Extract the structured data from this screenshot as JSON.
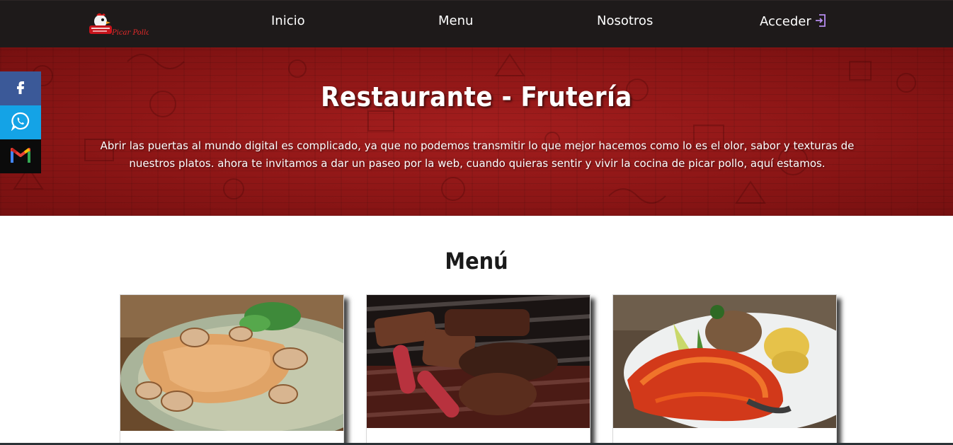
{
  "navbar": {
    "logo_icon": "restaurant-logo",
    "logo_text": "Picar Pollo",
    "links": [
      {
        "label": "Inicio"
      },
      {
        "label": "Menu"
      },
      {
        "label": "Nosotros"
      },
      {
        "label": "Acceder",
        "icon": "login-arrow-icon"
      }
    ]
  },
  "hero": {
    "title": "Restaurante - Frutería",
    "text": "Abrir las puertas al mundo digital es complicado, ya que no podemos transmitir lo que mejor hacemos como lo es el olor, sabor y texturas de nuestros platos. ahora te invitamos a dar un paseo por la web, cuando quieras sentir y vivir la cocina de picar pollo, aquí estamos."
  },
  "social": [
    {
      "icon": "facebook-icon"
    },
    {
      "icon": "whatsapp-icon"
    },
    {
      "icon": "gmail-icon"
    }
  ],
  "menu": {
    "title": "Menú",
    "cards": [
      {
        "image": "chicken-with-mushrooms-dish"
      },
      {
        "image": "grilled-meats-and-sausages"
      },
      {
        "image": "fish-in-tomato-sauce-with-rice"
      }
    ]
  },
  "colors": {
    "navbar": "#1e1a1a",
    "hero": "#8d1616",
    "facebook": "#3b5998",
    "whatsapp": "#14a3e6",
    "gmail_bg": "#0b0b0b"
  }
}
